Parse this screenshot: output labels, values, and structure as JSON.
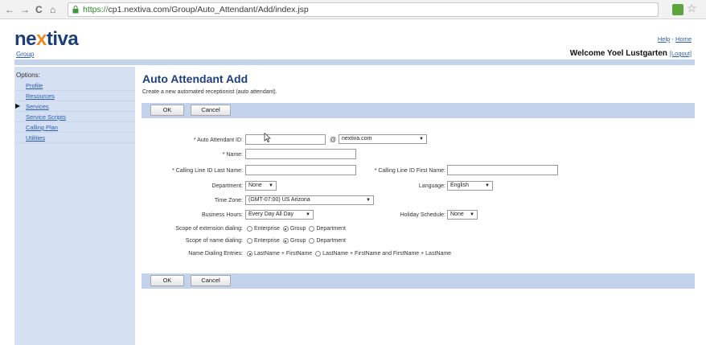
{
  "browser": {
    "url_scheme": "https://",
    "url_rest": "cp1.nextiva.com/Group/Auto_Attendant/Add/index.jsp"
  },
  "header": {
    "logo_prefix": "ne",
    "logo_accent": "x",
    "logo_suffix": "tiva",
    "group_link": "Group",
    "help_link": "Help",
    "home_link": "Home",
    "welcome": "Welcome Yoel Lustgarten",
    "logout": "[Logout]"
  },
  "sidebar": {
    "heading": "Options:",
    "items": [
      {
        "label": "Profile"
      },
      {
        "label": "Resources"
      },
      {
        "label": "Services",
        "bullet": "▶"
      },
      {
        "label": "Service Scripts"
      },
      {
        "label": "Calling Plan"
      },
      {
        "label": "Utilities"
      }
    ]
  },
  "main": {
    "title": "Auto Attendant Add",
    "description": "Create a new automated receptionist (auto attendant).",
    "ok_label": "OK",
    "cancel_label": "Cancel"
  },
  "form": {
    "aa_id_label": "* Auto Attendant ID:",
    "aa_id_value": "",
    "at_sign": "@",
    "domain_value": "nextiva.com",
    "name_label": "* Name:",
    "name_value": "",
    "cli_last_label": "* Calling Line ID Last Name:",
    "cli_last_value": "",
    "cli_first_label": "* Calling Line ID First Name:",
    "cli_first_value": "",
    "department_label": "Department:",
    "department_value": "None",
    "language_label": "Language:",
    "language_value": "English",
    "timezone_label": "Time Zone:",
    "timezone_value": "(GMT-07:00) US Arizona",
    "business_hours_label": "Business Hours:",
    "business_hours_value": "Every Day All Day",
    "holiday_label": "Holiday Schedule:",
    "holiday_value": "None",
    "scope_ext_label": "Scope of extension dialing:",
    "scope_name_label": "Scope of name dialing:",
    "scope_options": [
      "Enterprise",
      "Group",
      "Department"
    ],
    "name_entries_label": "Name Dialing Entries:",
    "name_entries_options": [
      "LastName + FirstName",
      "LastName + FirstName and FirstName + LastName"
    ]
  },
  "colors": {
    "accent_strip": "#c4d3ec",
    "sidebar_bg": "#d5e1f3",
    "title_blue": "#1e3f80",
    "logo_orange": "#ef8a1e"
  }
}
